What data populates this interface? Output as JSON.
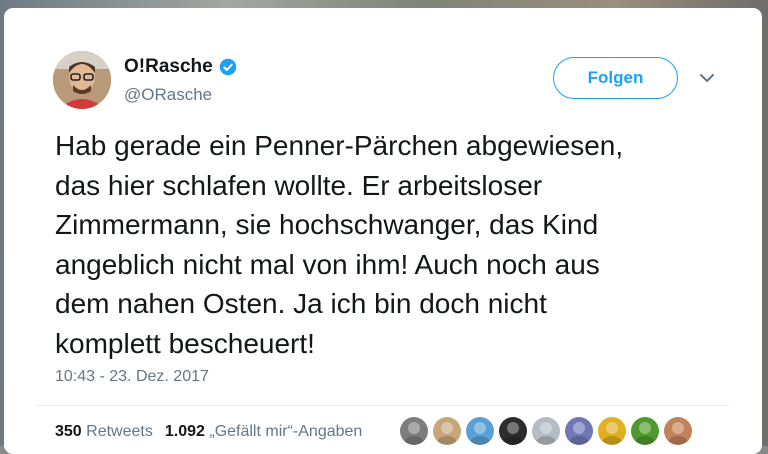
{
  "author": {
    "name": "O!Rasche",
    "handle": "@ORasche",
    "verified": true
  },
  "follow_button": {
    "label": "Folgen"
  },
  "tweet": {
    "text": "Hab gerade ein Penner-Pärchen abgewiesen,\ndas hier schlafen wollte. Er arbeitsloser\nZimmermann, sie hochschwanger, das Kind\nangeblich nicht mal von ihm! Auch noch aus\ndem nahen Osten. Ja ich bin doch nicht\nkomplett bescheuert!",
    "timestamp": "10:43 - 23. Dez. 2017"
  },
  "stats": {
    "retweets_count": "350",
    "retweets_label": "Retweets",
    "likes_count": "1.092",
    "likes_label": "„Gefällt mir“-Angaben"
  },
  "colors": {
    "accent": "#1da1f2",
    "text": "#14171a",
    "muted": "#657786",
    "divider": "#e6ecf0"
  },
  "icons": {
    "verified": "verified-badge-icon",
    "more": "chevron-down-icon"
  },
  "likers": [
    {
      "name": "liker-avatar-1",
      "color": "#7d7d7d"
    },
    {
      "name": "liker-avatar-2",
      "color": "#c7a77a"
    },
    {
      "name": "liker-avatar-3",
      "color": "#5aa0d6"
    },
    {
      "name": "liker-avatar-4",
      "color": "#2d2d2d"
    },
    {
      "name": "liker-avatar-5",
      "color": "#b4bcc4"
    },
    {
      "name": "liker-avatar-6",
      "color": "#6f78b5"
    },
    {
      "name": "liker-avatar-7",
      "color": "#e0b020"
    },
    {
      "name": "liker-avatar-8",
      "color": "#4f9a2c"
    },
    {
      "name": "liker-avatar-9",
      "color": "#c4825a"
    }
  ]
}
